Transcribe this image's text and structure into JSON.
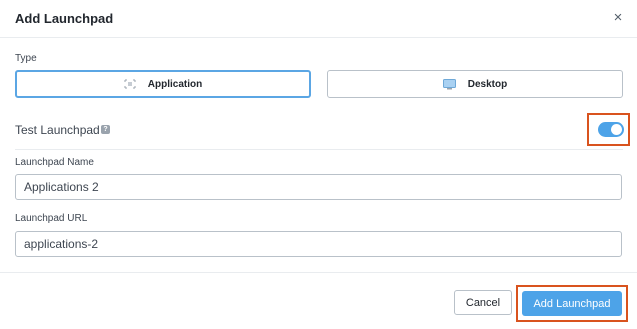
{
  "dialog": {
    "title": "Add Launchpad",
    "close_glyph": "×"
  },
  "type": {
    "label": "Type",
    "options": [
      {
        "label": "Application",
        "icon": "application-icon",
        "selected": true
      },
      {
        "label": "Desktop",
        "icon": "desktop-icon",
        "selected": false
      }
    ]
  },
  "test_launchpad": {
    "label": "Test Launchpad",
    "help_glyph": "?",
    "enabled": true
  },
  "name": {
    "label": "Launchpad Name",
    "value": "Applications 2"
  },
  "url": {
    "label": "Launchpad URL",
    "value": "applications-2"
  },
  "footer": {
    "cancel_label": "Cancel",
    "submit_label": "Add Launchpad"
  },
  "colors": {
    "accent": "#4da3e8",
    "highlight": "#d9531e"
  }
}
